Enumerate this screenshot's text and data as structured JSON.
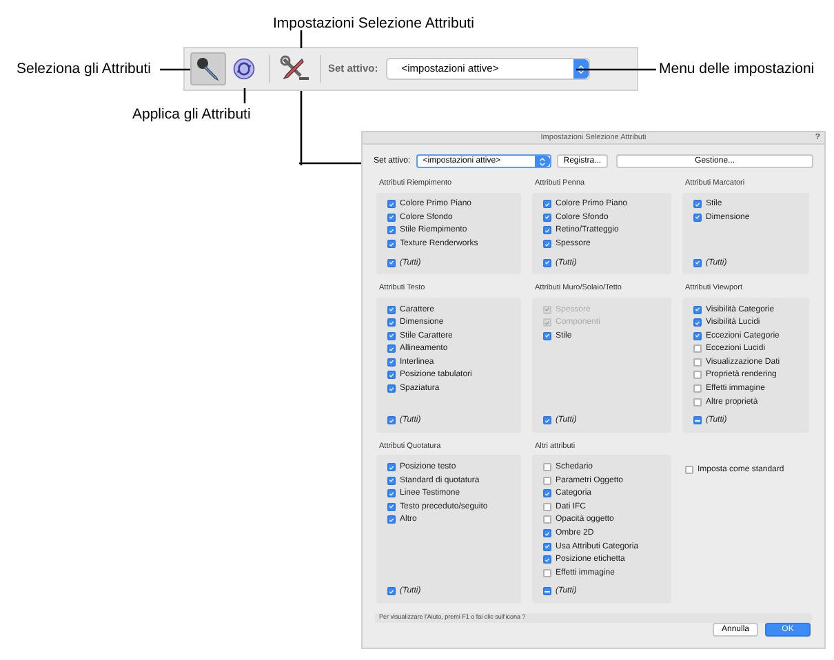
{
  "callouts": {
    "settings": "Impostazioni Selezione Attributi",
    "select": "Seleziona gli Attributi",
    "apply": "Applica gli Attributi",
    "menu": "Menu delle impostazioni"
  },
  "toolbar": {
    "tools": [
      {
        "kind": "eyedropper",
        "selected": true
      },
      {
        "kind": "apply",
        "selected": false
      },
      {
        "kind": "settings",
        "selected": false
      }
    ],
    "set_label": "Set attivo:",
    "set_value": "<impostazioni attive>"
  },
  "dialog": {
    "title": "Impostazioni Selezione Attributi",
    "help": "?",
    "set_label": "Set attivo:",
    "set_value": "<impostazioni attive>",
    "buttons": [
      "Registra...",
      "Gestione..."
    ],
    "groups": [
      {
        "title": "Attributi Riempimento",
        "items": [
          {
            "label": "Colore Primo Piano",
            "checked": true,
            "disabled": false
          },
          {
            "label": "Colore Sfondo",
            "checked": true,
            "disabled": false
          },
          {
            "label": "Stile Riempimento",
            "checked": true,
            "disabled": false
          },
          {
            "label": "Texture Renderworks",
            "checked": true,
            "disabled": false
          }
        ],
        "all": {
          "label": "(Tutti)",
          "checked": true,
          "mixed": false
        }
      },
      {
        "title": "Attributi Penna",
        "items": [
          {
            "label": "Colore Primo Piano",
            "checked": true,
            "disabled": false
          },
          {
            "label": "Colore Sfondo",
            "checked": true,
            "disabled": false
          },
          {
            "label": "Retino/Tratteggio",
            "checked": true,
            "disabled": false
          },
          {
            "label": "Spessore",
            "checked": true,
            "disabled": false
          }
        ],
        "all": {
          "label": "(Tutti)",
          "checked": true,
          "mixed": false
        }
      },
      {
        "title": "Attributi Marcatori",
        "items": [
          {
            "label": "Stile",
            "checked": true,
            "disabled": false
          },
          {
            "label": "Dimensione",
            "checked": true,
            "disabled": false
          }
        ],
        "all": {
          "label": "(Tutti)",
          "checked": true,
          "mixed": false
        }
      },
      {
        "title": "Attributi Testo",
        "items": [
          {
            "label": "Carattere",
            "checked": true,
            "disabled": false
          },
          {
            "label": "Dimensione",
            "checked": true,
            "disabled": false
          },
          {
            "label": "Stile Carattere",
            "checked": true,
            "disabled": false
          },
          {
            "label": "Allineamento",
            "checked": true,
            "disabled": false
          },
          {
            "label": "Interlinea",
            "checked": true,
            "disabled": false
          },
          {
            "label": "Posizione tabulatori",
            "checked": true,
            "disabled": false
          },
          {
            "label": "Spaziatura",
            "checked": true,
            "disabled": false
          }
        ],
        "all": {
          "label": "(Tutti)",
          "checked": true,
          "mixed": false
        }
      },
      {
        "title": "Attributi Muro/Solaio/Tetto",
        "items": [
          {
            "label": "Spessore",
            "checked": true,
            "disabled": true
          },
          {
            "label": "Componenti",
            "checked": true,
            "disabled": true
          },
          {
            "label": "Stile",
            "checked": true,
            "disabled": false
          }
        ],
        "all": {
          "label": "(Tutti)",
          "checked": true,
          "mixed": false
        }
      },
      {
        "title": "Attributi Viewport",
        "items": [
          {
            "label": "Visibilità Categorie",
            "checked": true,
            "disabled": false
          },
          {
            "label": "Visibilità Lucidi",
            "checked": true,
            "disabled": false
          },
          {
            "label": "Eccezioni Categorie",
            "checked": true,
            "disabled": false
          },
          {
            "label": "Eccezioni Lucidi",
            "checked": false,
            "disabled": false
          },
          {
            "label": "Visualizzazione Dati",
            "checked": false,
            "disabled": false
          },
          {
            "label": "Proprietà rendering",
            "checked": false,
            "disabled": false
          },
          {
            "label": "Effetti immagine",
            "checked": false,
            "disabled": false
          },
          {
            "label": "Altre proprietà",
            "checked": false,
            "disabled": false
          }
        ],
        "all": {
          "label": "(Tutti)",
          "mixed": true
        }
      },
      {
        "title": "Attributi Quotatura",
        "items": [
          {
            "label": "Posizione testo",
            "checked": true,
            "disabled": false
          },
          {
            "label": "Standard di quotatura",
            "checked": true,
            "disabled": false
          },
          {
            "label": "Linee Testimone",
            "checked": true,
            "disabled": false
          },
          {
            "label": "Testo preceduto/seguito",
            "checked": true,
            "disabled": false
          },
          {
            "label": "Altro",
            "checked": true,
            "disabled": false
          }
        ],
        "all": {
          "label": "(Tutti)",
          "checked": true,
          "mixed": false
        }
      },
      {
        "title": "Altri attributi",
        "items": [
          {
            "label": "Schedario",
            "checked": false,
            "disabled": false
          },
          {
            "label": "Parametri Oggetto",
            "checked": false,
            "disabled": false
          },
          {
            "label": "Categoria",
            "checked": true,
            "disabled": false
          },
          {
            "label": "Dati IFC",
            "checked": false,
            "disabled": false
          },
          {
            "label": "Opacità oggetto",
            "checked": false,
            "disabled": false
          },
          {
            "label": "Ombre 2D",
            "checked": true,
            "disabled": false
          },
          {
            "label": "Usa Attributi Categoria",
            "checked": true,
            "disabled": false
          },
          {
            "label": "Posizione etichetta",
            "checked": true,
            "disabled": false
          },
          {
            "label": "Effetti immagine",
            "checked": false,
            "disabled": false
          }
        ],
        "all": {
          "label": "(Tutti)",
          "mixed": true
        }
      }
    ],
    "standard": {
      "label": "Imposta come standard",
      "checked": false
    },
    "hint": "Per visualizzare l'Aiuto, premi F1 o fai clic sull'icona ?",
    "footer_buttons": [
      {
        "label": "Annulla",
        "default": false
      },
      {
        "label": "OK",
        "default": true
      }
    ]
  }
}
